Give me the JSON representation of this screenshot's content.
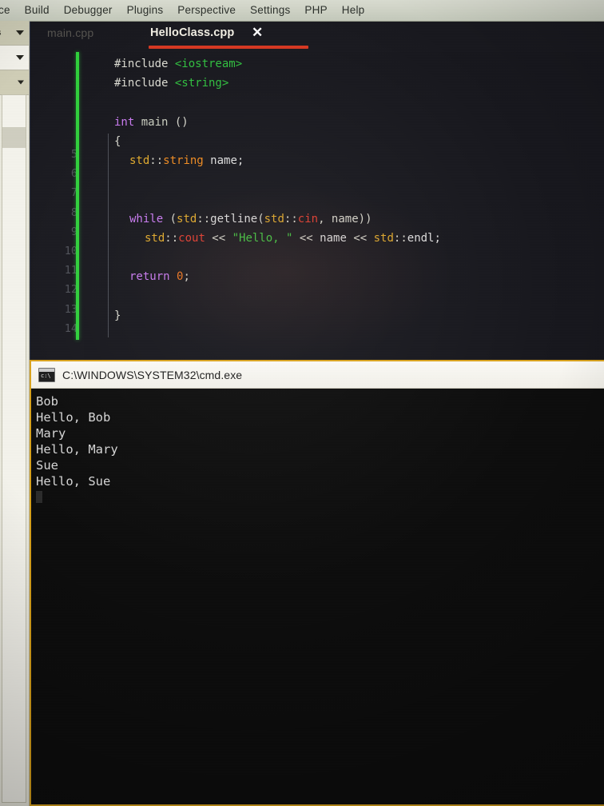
{
  "menubar": {
    "items": [
      {
        "label": "ce",
        "clipped": true
      },
      {
        "label": "Build"
      },
      {
        "label": "Debugger"
      },
      {
        "label": "Plugins"
      },
      {
        "label": "Perspective"
      },
      {
        "label": "Settings"
      },
      {
        "label": "PHP"
      },
      {
        "label": "Help"
      }
    ]
  },
  "sidepanel": {
    "rows": [
      {
        "label": "s",
        "caret": "chevron-down-icon"
      },
      {
        "label": "",
        "caret": "chevron-down-icon"
      },
      {
        "label": "",
        "caret": "chevron-down-icon"
      }
    ]
  },
  "editor": {
    "tabs": [
      {
        "label": "main.cpp",
        "active": false
      },
      {
        "label": "HelloClass.cpp",
        "active": true,
        "close_label": "✕"
      }
    ],
    "active_tab_accent": "#d6361f",
    "line_numbers": [
      "5",
      "6",
      "7",
      "8",
      "9",
      "10",
      "11",
      "12",
      "13",
      "14"
    ],
    "code_lines": [
      {
        "indent": 0,
        "tokens": [
          {
            "t": "#include ",
            "c": "t-pre"
          },
          {
            "t": "<iostream>",
            "c": "t-hdr"
          }
        ]
      },
      {
        "indent": 0,
        "tokens": [
          {
            "t": "#include ",
            "c": "t-pre"
          },
          {
            "t": "<string>",
            "c": "t-hdr"
          }
        ]
      },
      {
        "indent": 0,
        "tokens": []
      },
      {
        "indent": 0,
        "tokens": [
          {
            "t": "int",
            "c": "t-kw"
          },
          {
            "t": " ",
            "c": "t-punct"
          },
          {
            "t": "main",
            "c": "t-fn"
          },
          {
            "t": " ()",
            "c": "t-punct"
          }
        ]
      },
      {
        "indent": 0,
        "tokens": [
          {
            "t": "{",
            "c": "t-punct"
          }
        ]
      },
      {
        "indent": 1,
        "tokens": [
          {
            "t": "std",
            "c": "t-ns"
          },
          {
            "t": "::",
            "c": "t-punct"
          },
          {
            "t": "string",
            "c": "t-type"
          },
          {
            "t": " name;",
            "c": "t-var"
          }
        ]
      },
      {
        "indent": 0,
        "tokens": []
      },
      {
        "indent": 0,
        "tokens": []
      },
      {
        "indent": 1,
        "tokens": [
          {
            "t": "while",
            "c": "t-kw"
          },
          {
            "t": " (",
            "c": "t-punct"
          },
          {
            "t": "std",
            "c": "t-ns"
          },
          {
            "t": "::",
            "c": "t-punct"
          },
          {
            "t": "getline",
            "c": "t-var"
          },
          {
            "t": "(",
            "c": "t-punct"
          },
          {
            "t": "std",
            "c": "t-ns"
          },
          {
            "t": "::",
            "c": "t-punct"
          },
          {
            "t": "cin",
            "c": "t-strm"
          },
          {
            "t": ", name))",
            "c": "t-punct"
          }
        ]
      },
      {
        "indent": 2,
        "tokens": [
          {
            "t": "std",
            "c": "t-ns"
          },
          {
            "t": "::",
            "c": "t-punct"
          },
          {
            "t": "cout",
            "c": "t-strm"
          },
          {
            "t": " << ",
            "c": "t-op"
          },
          {
            "t": "\"Hello, \"",
            "c": "t-str"
          },
          {
            "t": " << ",
            "c": "t-op"
          },
          {
            "t": "name",
            "c": "t-var"
          },
          {
            "t": " << ",
            "c": "t-op"
          },
          {
            "t": "std",
            "c": "t-ns"
          },
          {
            "t": "::",
            "c": "t-punct"
          },
          {
            "t": "endl;",
            "c": "t-var"
          }
        ]
      },
      {
        "indent": 0,
        "tokens": []
      },
      {
        "indent": 1,
        "tokens": [
          {
            "t": "return",
            "c": "t-kw"
          },
          {
            "t": " ",
            "c": "t-punct"
          },
          {
            "t": "0",
            "c": "t-num"
          },
          {
            "t": ";",
            "c": "t-punct"
          }
        ]
      },
      {
        "indent": 0,
        "tokens": []
      },
      {
        "indent": 0,
        "tokens": [
          {
            "t": "}",
            "c": "t-punct"
          }
        ]
      }
    ]
  },
  "console": {
    "title": "C:\\WINDOWS\\SYSTEM32\\cmd.exe",
    "icon": "cmd-icon",
    "border_color": "#d9a21c",
    "output": [
      "Bob",
      "Hello, Bob",
      "Mary",
      "Hello, Mary",
      "Sue",
      "Hello, Sue"
    ]
  }
}
